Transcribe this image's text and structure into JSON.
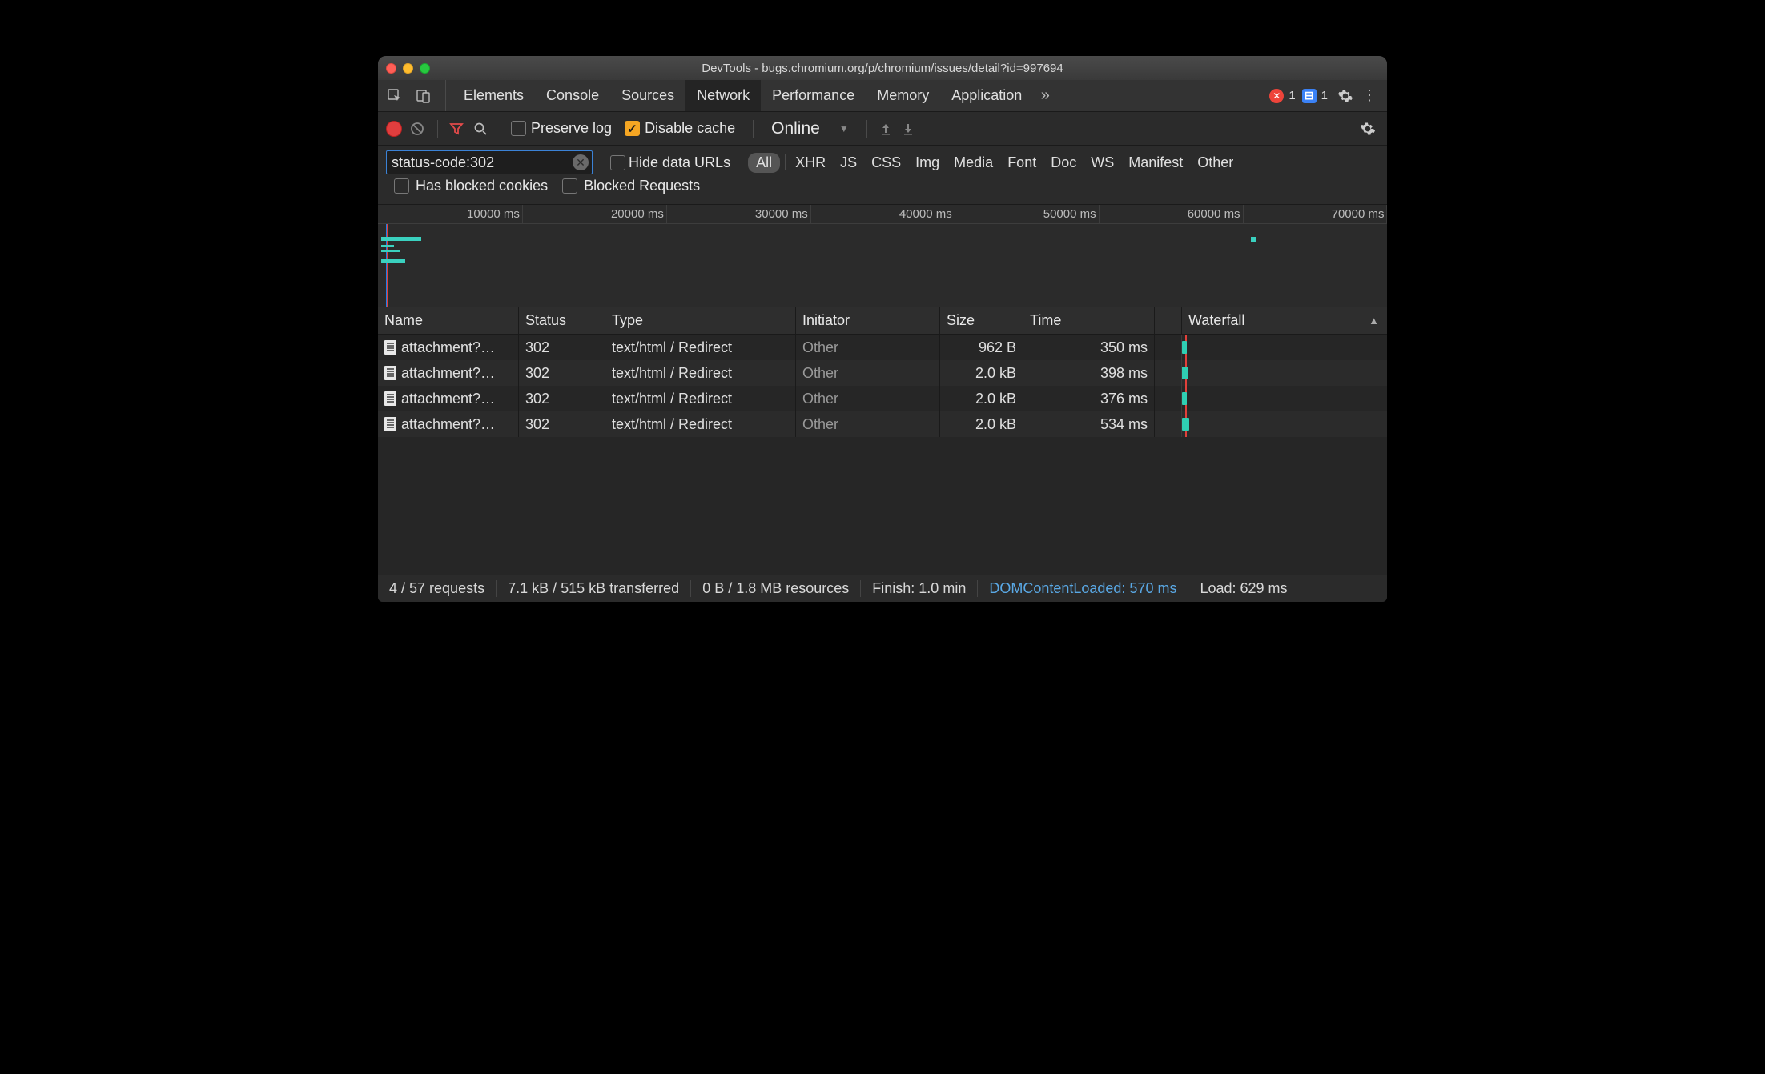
{
  "window": {
    "title": "DevTools - bugs.chromium.org/p/chromium/issues/detail?id=997694"
  },
  "tabs": {
    "items": [
      "Elements",
      "Console",
      "Sources",
      "Network",
      "Performance",
      "Memory",
      "Application"
    ],
    "active": "Network",
    "overflow": "»",
    "errors_count": "1",
    "issues_count": "1"
  },
  "toolbar": {
    "preserve_log_label": "Preserve log",
    "preserve_log_checked": false,
    "disable_cache_label": "Disable cache",
    "disable_cache_checked": true,
    "throttling_value": "Online"
  },
  "filter": {
    "value": "status-code:302",
    "hide_data_urls_label": "Hide data URLs",
    "hide_data_urls_checked": false,
    "categories": [
      "All",
      "XHR",
      "JS",
      "CSS",
      "Img",
      "Media",
      "Font",
      "Doc",
      "WS",
      "Manifest",
      "Other"
    ],
    "selected_category": "All",
    "blocked_cookies_label": "Has blocked cookies",
    "blocked_cookies_checked": false,
    "blocked_requests_label": "Blocked Requests",
    "blocked_requests_checked": false
  },
  "overview": {
    "ticks": [
      {
        "label": "10000 ms",
        "pct": 14.28
      },
      {
        "label": "20000 ms",
        "pct": 28.56
      },
      {
        "label": "30000 ms",
        "pct": 42.84
      },
      {
        "label": "40000 ms",
        "pct": 57.12
      },
      {
        "label": "50000 ms",
        "pct": 71.4
      },
      {
        "label": "60000 ms",
        "pct": 85.68
      },
      {
        "label": "70000 ms",
        "pct": 99.96
      }
    ]
  },
  "grid": {
    "columns": [
      "Name",
      "Status",
      "Type",
      "Initiator",
      "Size",
      "Time",
      "",
      "Waterfall"
    ],
    "sorted_column": "Waterfall",
    "rows": [
      {
        "name": "attachment?…",
        "status": "302",
        "type": "text/html / Redirect",
        "initiator": "Other",
        "size": "962 B",
        "time": "350 ms",
        "wf_start": 0,
        "wf_len": 6
      },
      {
        "name": "attachment?…",
        "status": "302",
        "type": "text/html / Redirect",
        "initiator": "Other",
        "size": "2.0 kB",
        "time": "398 ms",
        "wf_start": 0,
        "wf_len": 7
      },
      {
        "name": "attachment?…",
        "status": "302",
        "type": "text/html / Redirect",
        "initiator": "Other",
        "size": "2.0 kB",
        "time": "376 ms",
        "wf_start": 0,
        "wf_len": 6
      },
      {
        "name": "attachment?…",
        "status": "302",
        "type": "text/html / Redirect",
        "initiator": "Other",
        "size": "2.0 kB",
        "time": "534 ms",
        "wf_start": 0,
        "wf_len": 9
      }
    ]
  },
  "status": {
    "requests": "4 / 57 requests",
    "transferred": "7.1 kB / 515 kB transferred",
    "resources": "0 B / 1.8 MB resources",
    "finish": "Finish: 1.0 min",
    "dom": "DOMContentLoaded: 570 ms",
    "load": "Load: 629 ms"
  }
}
